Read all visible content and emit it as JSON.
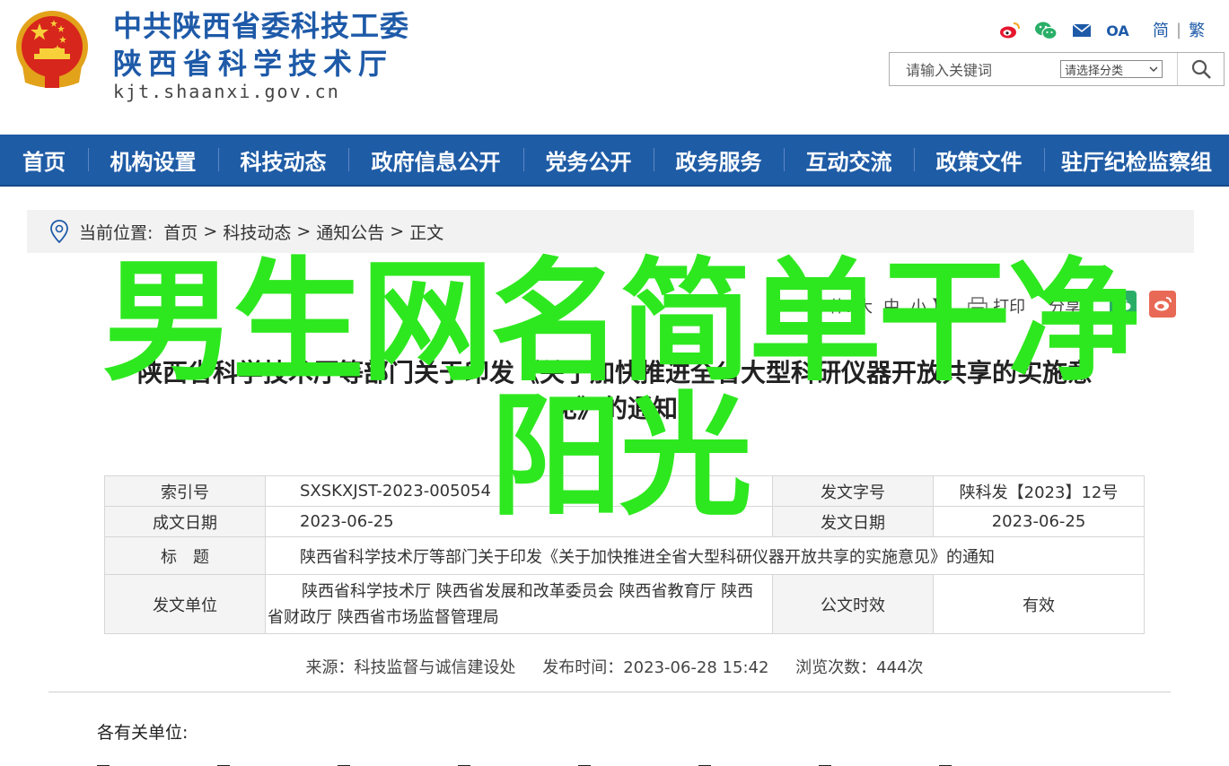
{
  "header": {
    "title_line1": "中共陕西省委科技工委",
    "title_line2": "陕西省科学技术厅",
    "domain": "kjt.shaanxi.gov.cn",
    "oa_label": "OA",
    "lang_simplified": "简",
    "lang_separator": "|",
    "lang_traditional": "繁",
    "icons": [
      "weibo-icon",
      "wechat-icon",
      "mail-icon",
      "oa-icon"
    ],
    "search": {
      "placeholder": "请输入关键词",
      "category_label": "请选择分类"
    }
  },
  "nav": {
    "items": [
      {
        "label": "首页"
      },
      {
        "label": "机构设置"
      },
      {
        "label": "科技动态"
      },
      {
        "label": "政府信息公开"
      },
      {
        "label": "党务公开"
      },
      {
        "label": "政务服务"
      },
      {
        "label": "互动交流"
      },
      {
        "label": "政策文件"
      },
      {
        "label": "驻厅纪检监察组"
      }
    ]
  },
  "breadcrumb": {
    "prefix": "当前位置:",
    "items": [
      "首页",
      "科技动态",
      "通知公告",
      "正文"
    ],
    "separator": ">"
  },
  "tools": {
    "font_prefix": "【字体:",
    "size_large": "大",
    "size_medium": "中",
    "size_small": "小",
    "font_suffix": "】",
    "print": "打印",
    "share": "分享"
  },
  "article": {
    "title_line1": "陕西省科学技术厅等部门关于印发《关于加快推进全省大型科研仪器开放共享的实施意",
    "title_line2": "见》的通知"
  },
  "info": {
    "index_label": "索引号",
    "index_value": "SXSKXJST-2023-005054",
    "doc_no_label": "发文字号",
    "doc_no_value": "陕科发【2023】12号",
    "written_date_label": "成文日期",
    "written_date_value": "2023-06-25",
    "issue_date_label": "发文日期",
    "issue_date_value": "2023-06-25",
    "subject_label": "标　题",
    "subject_value": "陕西省科学技术厅等部门关于印发《关于加快推进全省大型科研仪器开放共享的实施意见》的通知",
    "issuer_label": "发文单位",
    "issuer_value": "陕西省科学技术厅 陕西省发展和改革委员会 陕西省教育厅 陕西省财政厅 陕西省市场监督管理局",
    "validity_label": "公文时效",
    "validity_value": "有效"
  },
  "meta": {
    "source": "来源：科技监督与诚信建设处",
    "published": "发布时间：2023-06-28 15:42",
    "views": "浏览次数：444次"
  },
  "body": {
    "salutation": "各有关单位:"
  },
  "overlay": {
    "line1": "男生网名简单干净",
    "line2": "阳光"
  },
  "colors": {
    "brand_blue": "#1f5ca6",
    "overlay_green": "#2ee81f"
  }
}
